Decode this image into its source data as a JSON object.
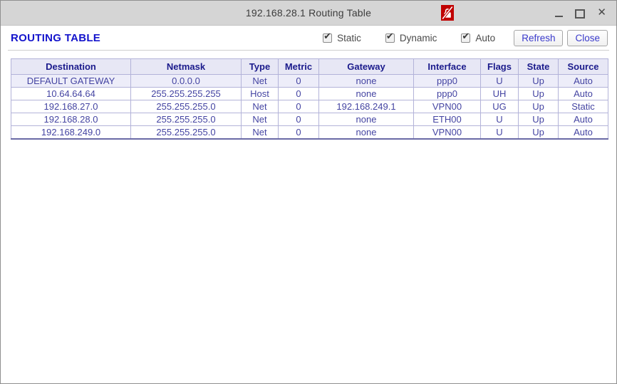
{
  "window": {
    "title": "192.168.28.1  Routing Table"
  },
  "icons": {
    "titlebar_badge": "insecure-lock-slash-icon",
    "badge_color": "#c00000"
  },
  "toolbar": {
    "heading": "ROUTING TABLE",
    "filters": [
      {
        "label": "Static",
        "checked": true
      },
      {
        "label": "Dynamic",
        "checked": true
      },
      {
        "label": "Auto",
        "checked": true
      }
    ],
    "refresh_label": "Refresh",
    "close_label": "Close"
  },
  "table": {
    "headers": [
      "Destination",
      "Netmask",
      "Type",
      "Metric",
      "Gateway",
      "Interface",
      "Flags",
      "State",
      "Source"
    ],
    "rows": [
      [
        "DEFAULT GATEWAY",
        "0.0.0.0",
        "Net",
        "0",
        "none",
        "ppp0",
        "U",
        "Up",
        "Auto"
      ],
      [
        "10.64.64.64",
        "255.255.255.255",
        "Host",
        "0",
        "none",
        "ppp0",
        "UH",
        "Up",
        "Auto"
      ],
      [
        "192.168.27.0",
        "255.255.255.0",
        "Net",
        "0",
        "192.168.249.1",
        "VPN00",
        "UG",
        "Up",
        "Static"
      ],
      [
        "192.168.28.0",
        "255.255.255.0",
        "Net",
        "0",
        "none",
        "ETH00",
        "U",
        "Up",
        "Auto"
      ],
      [
        "192.168.249.0",
        "255.255.255.0",
        "Net",
        "0",
        "none",
        "VPN00",
        "U",
        "Up",
        "Auto"
      ]
    ]
  },
  "colors": {
    "heading_blue": "#1414cc",
    "header_text_navy": "#1b1b8c",
    "cell_text_purple": "#4444a2",
    "table_border": "#b3b3d9",
    "titlebar_gray": "#d5d5d5",
    "badge_red": "#c00000"
  }
}
